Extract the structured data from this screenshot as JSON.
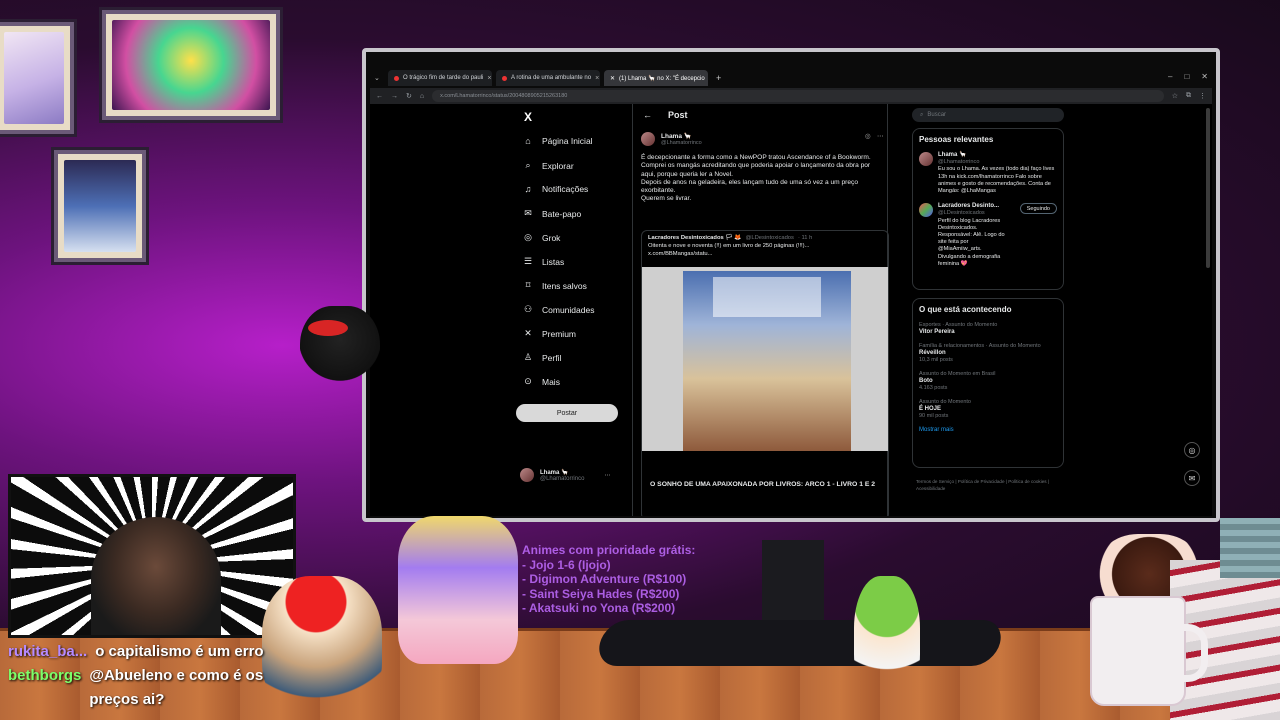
{
  "browser": {
    "tabs": [
      {
        "label": "O trágico fim de tarde do pauli",
        "active": false
      },
      {
        "label": "A rotina de uma ambulante no",
        "active": false
      },
      {
        "label": "(1) Lhama 🦙 no X: \"É decepcio",
        "active": true
      }
    ],
    "new_tab": "+",
    "url": "x.com/Lhamatorrinco/status/2004808905215263180"
  },
  "x": {
    "logo": "X",
    "nav": [
      {
        "icon": "home-icon",
        "glyph": "⌂",
        "label": "Página Inicial"
      },
      {
        "icon": "search-icon",
        "glyph": "⌕",
        "label": "Explorar"
      },
      {
        "icon": "bell-icon",
        "glyph": "♫",
        "label": "Notificações"
      },
      {
        "icon": "mail-icon",
        "glyph": "✉",
        "label": "Bate-papo"
      },
      {
        "icon": "grok-icon",
        "glyph": "◎",
        "label": "Grok"
      },
      {
        "icon": "list-icon",
        "glyph": "☰",
        "label": "Listas"
      },
      {
        "icon": "bookmark-icon",
        "glyph": "⌑",
        "label": "Itens salvos"
      },
      {
        "icon": "communities-icon",
        "glyph": "⚇",
        "label": "Comunidades"
      },
      {
        "icon": "x-premium-icon",
        "glyph": "✕",
        "label": "Premium"
      },
      {
        "icon": "profile-icon",
        "glyph": "♙",
        "label": "Perfil"
      },
      {
        "icon": "more-icon",
        "glyph": "⊙",
        "label": "Mais"
      }
    ],
    "post_button": "Postar",
    "account": {
      "name": "Lhama 🦙",
      "handle": "@Lhamatorrinco"
    },
    "feed": {
      "back": "←",
      "title": "Post",
      "author": {
        "name": "Lhama 🦙",
        "handle": "@Lhamatorrinco"
      },
      "text_lines": [
        "É decepcionante a forma como a NewPOP tratou Ascendance of a Bookworm.",
        "Comprei os mangás acreditando que poderia apoiar o lançamento da obra por aqui, porque queria ler a Novel.",
        "Depois de anos na geladeira, eles lançam tudo de uma só vez a um preço exorbitante.",
        "Querem se livrar."
      ],
      "quote": {
        "name": "Lacradores Desintoxicados 🏳 🦊",
        "handle": "@LDesintoxicados",
        "time": "· 11 h",
        "text": "Oitenta e nove e noventa (!!) em um livro de 250 páginas (!!!)...",
        "link": "x.com/BBMangas/statu...",
        "book_title": "O SONHO DE UMA APAIXONADA POR LIVROS: ARCO 1 - LIVRO 1 E 2"
      }
    },
    "search_placeholder": "Buscar",
    "relevant": {
      "title": "Pessoas relevantes",
      "people": [
        {
          "name": "Lhama 🦙",
          "handle": "@Lhamatorrinco",
          "bio": "Eu sou o Lhama. As vezes (todo dia) faço lives 13h na kick.com/lhamatorrinco Falo sobre animes e gosto de recomendações. Conta de Mangás: @LhaMangas",
          "action": ""
        },
        {
          "name": "Lacradores Desinto...",
          "handle": "@LDesintoxicados",
          "bio": "Perfil do blog Lacradores Desintoxicados. Responsável: Alê. Logo do site feita por @MiaAmiiw_arts. Divulgando a demografia feminina 💖",
          "action": "Seguindo"
        }
      ]
    },
    "trends": {
      "title": "O que está acontecendo",
      "items": [
        {
          "category": "Esportes · Assunto do Momento",
          "topic": "Vitor Pereira",
          "count": ""
        },
        {
          "category": "Família & relacionamentos · Assunto do Momento",
          "topic": "Réveillon",
          "count": "10,3 mil posts"
        },
        {
          "category": "Assunto do Momento em Brasil",
          "topic": "Boto",
          "count": "4.163 posts"
        },
        {
          "category": "Assunto do Momento",
          "topic": "É HOJE",
          "count": "90 mil posts"
        }
      ],
      "more": "Mostrar mais"
    },
    "footer": "Termos de Serviço | Política de Privacidade | Política de cookies | Acessibilidade"
  },
  "stream": {
    "chat": [
      {
        "user": "rukita_ba...",
        "message": "o capitalismo é um erro"
      },
      {
        "user": "bethborgs",
        "message": "@Abueleno e como é os preços ai?"
      }
    ],
    "priority": {
      "title": "Animes com prioridade grátis:",
      "items": [
        "- Jojo 1-6 (Ijojo)",
        "- Digimon Adventure (R$100)",
        "- Saint Seiya Hades (R$200)",
        "- Akatsuki no Yona (R$200)"
      ]
    }
  }
}
